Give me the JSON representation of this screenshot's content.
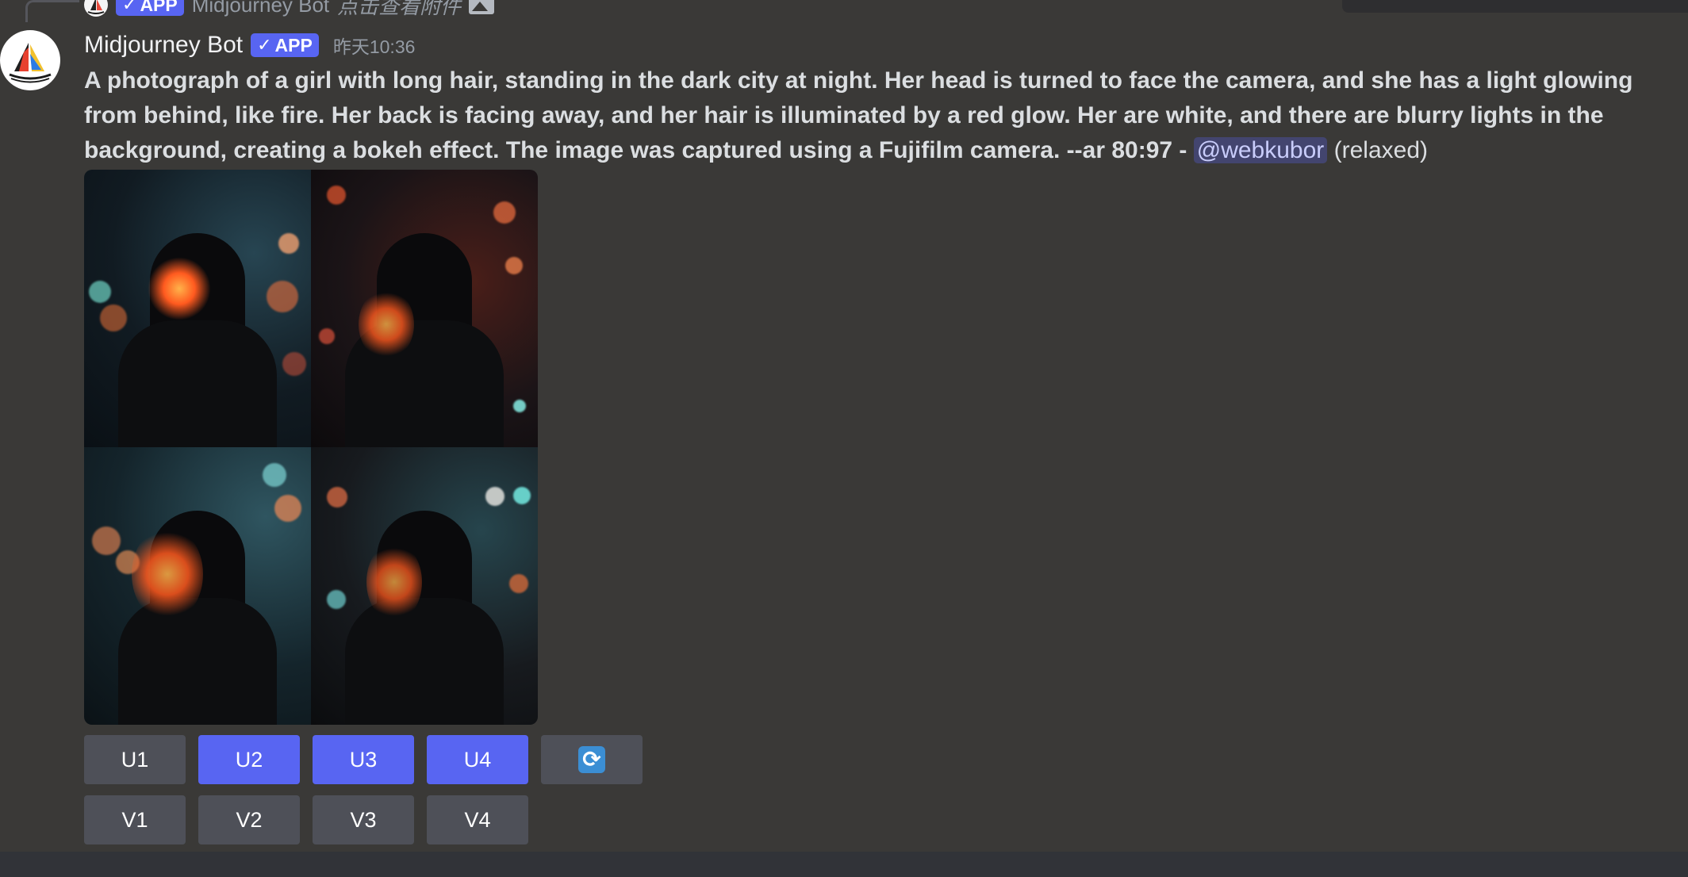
{
  "reply": {
    "app_badge": "APP",
    "author": "Midjourney Bot",
    "preview_text": "点击查看附件"
  },
  "message": {
    "author": "Midjourney Bot",
    "app_badge": "APP",
    "timestamp": "昨天10:36",
    "prompt": "A photograph of a girl with long hair, standing in the dark city at night. Her head is turned to face the camera, and she has a light glowing from behind, like fire. Her back is facing away, and her hair is illuminated by a red glow. Her are white, and there are blurry lights in the background, creating a bokeh effect. The image was captured using a Fujifilm camera. --ar 80:97",
    "separator": " - ",
    "mention": "@webkubor",
    "mode": " (relaxed)"
  },
  "buttons": {
    "upscale": [
      {
        "label": "U1",
        "style": "grey"
      },
      {
        "label": "U2",
        "style": "blue"
      },
      {
        "label": "U3",
        "style": "blue"
      },
      {
        "label": "U4",
        "style": "blue"
      }
    ],
    "reroll_icon": "refresh-icon",
    "variation": [
      {
        "label": "V1"
      },
      {
        "label": "V2"
      },
      {
        "label": "V3"
      },
      {
        "label": "V4"
      }
    ]
  },
  "colors": {
    "background": "#3a3937",
    "blurple": "#5865f2",
    "button_grey": "#4e5058",
    "mention_bg": "#4c518f"
  }
}
